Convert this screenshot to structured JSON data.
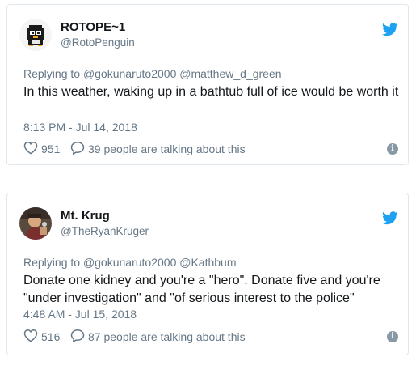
{
  "tweets": [
    {
      "display_name": "ROTOPE~1",
      "handle": "@RotoPenguin",
      "reply_prefix": "Replying to",
      "reply_to": "@gokunaruto2000 @matthew_d_green",
      "text": "In this weather, waking up in a bathtub full of ice would be worth it",
      "timestamp": "8:13 PM - Jul 14, 2018",
      "likes": "951",
      "conversation": "39 people are talking about this",
      "info": "i"
    },
    {
      "display_name": "Mt. Krug",
      "handle": "@TheRyanKruger",
      "reply_prefix": "Replying to",
      "reply_to": "@gokunaruto2000 @Kathbum",
      "text": "Donate one kidney and you're a \"hero\". Donate five and you're \"under investigation\" and \"of serious interest to the police\"",
      "timestamp": "4:48 AM - Jul 15, 2018",
      "likes": "516",
      "conversation": "87 people are talking about this",
      "info": "i"
    }
  ],
  "colors": {
    "twitter_blue": "#1da1f2",
    "muted": "#657786",
    "text": "#14171a",
    "border": "#e1e8ed"
  },
  "icons": [
    "twitter-bird-icon",
    "heart-icon",
    "speech-bubble-icon",
    "info-icon"
  ]
}
